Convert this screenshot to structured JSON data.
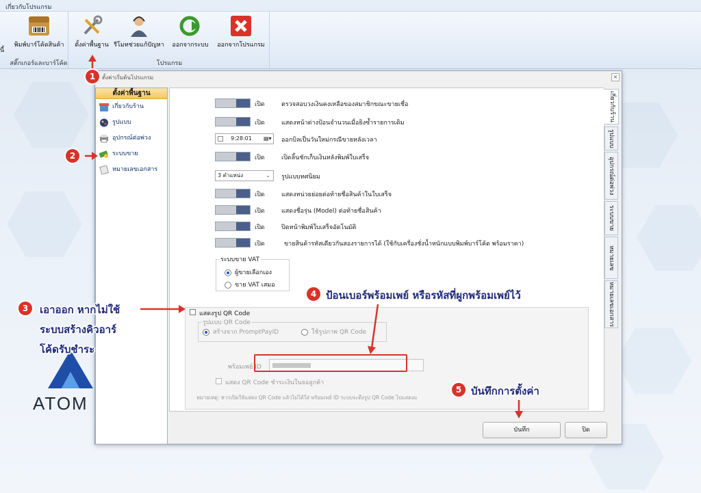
{
  "window": {
    "title": "เกี่ยวกับโปรแกรม"
  },
  "ribbon": {
    "cutoff_label": "นี้",
    "group_sticker": {
      "caption": "สติ๊กเกอร์และบาร์โค้ด",
      "buttons": [
        {
          "label": "พิมพ์บาร์โค้ดสินค้า",
          "icon": "barcode-box-icon"
        }
      ]
    },
    "group_program": {
      "caption": "โปรแกรม",
      "buttons": [
        {
          "label": "ตั้งค่าพื้นฐาน",
          "icon": "tools-icon"
        },
        {
          "label": "รีโมทช่วยแก้ปัญหา",
          "icon": "support-agent-icon"
        },
        {
          "label": "ออกจากระบบ",
          "icon": "logout-arrow-icon"
        },
        {
          "label": "ออกจากโปรแกรม",
          "icon": "close-red-icon"
        }
      ]
    }
  },
  "dialog": {
    "title": "ตั้งค่าเริ่มต้นโปรแกรม",
    "nav": {
      "header": "ตั้งค่าพื้นฐาน",
      "items": [
        {
          "label": "เกี่ยวกับร้าน",
          "icon": "shop-icon"
        },
        {
          "label": "รูปแบบ",
          "icon": "palette-icon"
        },
        {
          "label": "อุปกรณ์ต่อพ่วง",
          "icon": "printer-icon"
        },
        {
          "label": "ระบบขาย",
          "icon": "money-icon"
        },
        {
          "label": "หมายเลขเอกสาร",
          "icon": "document-icon"
        }
      ]
    },
    "tabs": [
      "เกี่ยวกับร้าน",
      "รูปแบบ",
      "อุปกรณ์ต่อพ่วง",
      "ระบบขาย",
      "หมายเลขเอกสาร",
      "หมายเลขเอกสาร"
    ],
    "toggle_on_label": "เปิด",
    "settings": [
      "ตรวจสอบวงเงินคงเหลือของสมาชิกขณะขายเชื่อ",
      "แสดงหน้าต่างป้อนจำนวนเมื่อยิงซ้ำรายการเดิม",
      "ออกบิลเป็นวันใหม่กรณีขายหลังเวลา",
      "เปิดลิ้นชักเก็บเงินหลังพิมพ์ใบเสร็จ",
      "รูปแบบทศนิยม",
      "แสดงหน่วยย่อยต่อท้ายชื่อสินค้าในใบเสร็จ",
      "แสดงชื่อรุ่น (Model) ต่อท้ายชื่อสินค้า",
      "ปิดหน้าพิมพ์ใบเสร็จอัตโนมัติ",
      "ขายสินค้ารหัสเดียวกันสองรายการได้ (ใช้กับเครื่องชั่งน้ำหนักแบบพิมพ์บาร์โค้ด พร้อมราคา)"
    ],
    "time_value": "9:28:01",
    "decimal_selected": "3 ตำแหน่ง",
    "vat": {
      "legend": "ระบบขาย VAT",
      "options": [
        "ผู้ขายเลือกเอง",
        "ขาย VAT เสมอ"
      ],
      "selected": 0
    },
    "qr": {
      "show_label": "แสดงรูป QR Code",
      "style_legend": "รูปแบบ QR Code",
      "style_options": [
        "สร้างจาก PromptPayID",
        "ใช้รูปภาพ QR Code"
      ],
      "promptpay_label": "พร้อมเพย์ ID",
      "customer_screen_label": "แสดง QR Code ชำระเงินในจอลูกค้า",
      "note": "หมายเหตุ: หากเปิดให้แสดง QR Code แล้วไม่ได้ใส่ พร้อมเพย์ ID ระบบจะดึงรูป QR Code ไปแสดงแ"
    },
    "buttons": {
      "save": "บันทึก",
      "close": "ปิด"
    }
  },
  "annotations": {
    "badges": [
      "1",
      "2",
      "3",
      "4",
      "5"
    ],
    "note3_lines": [
      "เอาออก หากไม่ใช้",
      "ระบบสร้างคิวอาร์",
      "โค้ดรับชำระ"
    ],
    "note4": "ป้อนเบอร์พร้อมเพย์ หรือรหัสที่ผูกพร้อมเพย์ไว้",
    "note5": "บันทึกการตั้งค่า",
    "color": "#d9322a"
  },
  "brand": {
    "logo_text": "ATOM"
  }
}
